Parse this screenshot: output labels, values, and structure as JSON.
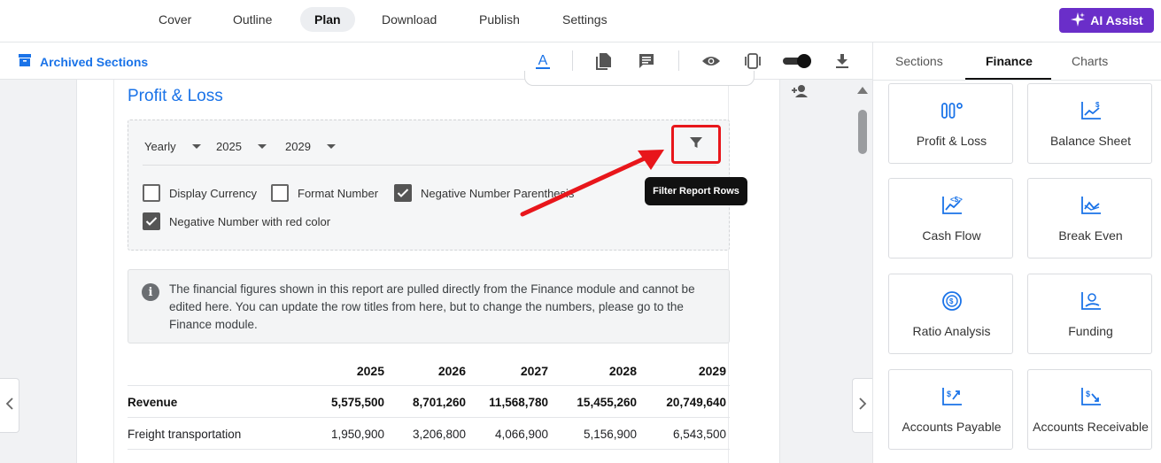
{
  "nav": {
    "tabs": [
      {
        "label": "Cover"
      },
      {
        "label": "Outline"
      },
      {
        "label": "Plan",
        "active": true
      },
      {
        "label": "Download"
      },
      {
        "label": "Publish"
      },
      {
        "label": "Settings"
      }
    ],
    "ai_assist_label": "AI Assist",
    "ai_color": "#6a2ec9"
  },
  "toolbar": {
    "archived_label": "Archived Sections",
    "icons": [
      "text-format-icon",
      "copy-page-icon",
      "comment-icon",
      "eye-icon",
      "device-preview-icon",
      "toggle-switch",
      "download-icon"
    ]
  },
  "section": {
    "title": "Profit & Loss",
    "period_select": "Yearly",
    "start_year_select": "2025",
    "end_year_select": "2029",
    "checkboxes": [
      {
        "label": "Display Currency",
        "checked": false
      },
      {
        "label": "Format Number",
        "checked": false
      },
      {
        "label": "Negative Number Parenthesis",
        "checked": true
      },
      {
        "label": "Negative Number with red color",
        "checked": true
      }
    ],
    "filter_tooltip": "Filter Report Rows",
    "info_text": "The financial figures shown in this report are pulled directly from the Finance module and cannot be edited here. You can update the row titles from here, but to change the numbers, please go to the Finance module."
  },
  "table": {
    "columns": [
      "2025",
      "2026",
      "2027",
      "2028",
      "2029"
    ],
    "rows": [
      {
        "label": "Revenue",
        "bold": true,
        "values": [
          "5,575,500",
          "8,701,260",
          "11,568,780",
          "15,455,260",
          "20,749,640"
        ]
      },
      {
        "label": "Freight transportation",
        "bold": false,
        "values": [
          "1,950,900",
          "3,206,800",
          "4,066,900",
          "5,156,900",
          "6,543,500"
        ]
      }
    ]
  },
  "right_panel": {
    "tabs": [
      {
        "label": "Sections"
      },
      {
        "label": "Finance",
        "active": true
      },
      {
        "label": "Charts"
      }
    ],
    "cards": [
      {
        "label": "Profit & Loss",
        "icon": "columns-icon"
      },
      {
        "label": "Balance Sheet",
        "icon": "chart-dollar-icon"
      },
      {
        "label": "Cash Flow",
        "icon": "cash-flow-icon"
      },
      {
        "label": "Break Even",
        "icon": "line-chart-icon"
      },
      {
        "label": "Ratio Analysis",
        "icon": "ratio-icon"
      },
      {
        "label": "Funding",
        "icon": "funding-icon"
      },
      {
        "label": "Accounts Payable",
        "icon": "payable-icon"
      },
      {
        "label": "Accounts Receivable",
        "icon": "receivable-icon"
      }
    ]
  },
  "colors": {
    "accent": "#1a73e8",
    "highlight": "#e8161b"
  }
}
